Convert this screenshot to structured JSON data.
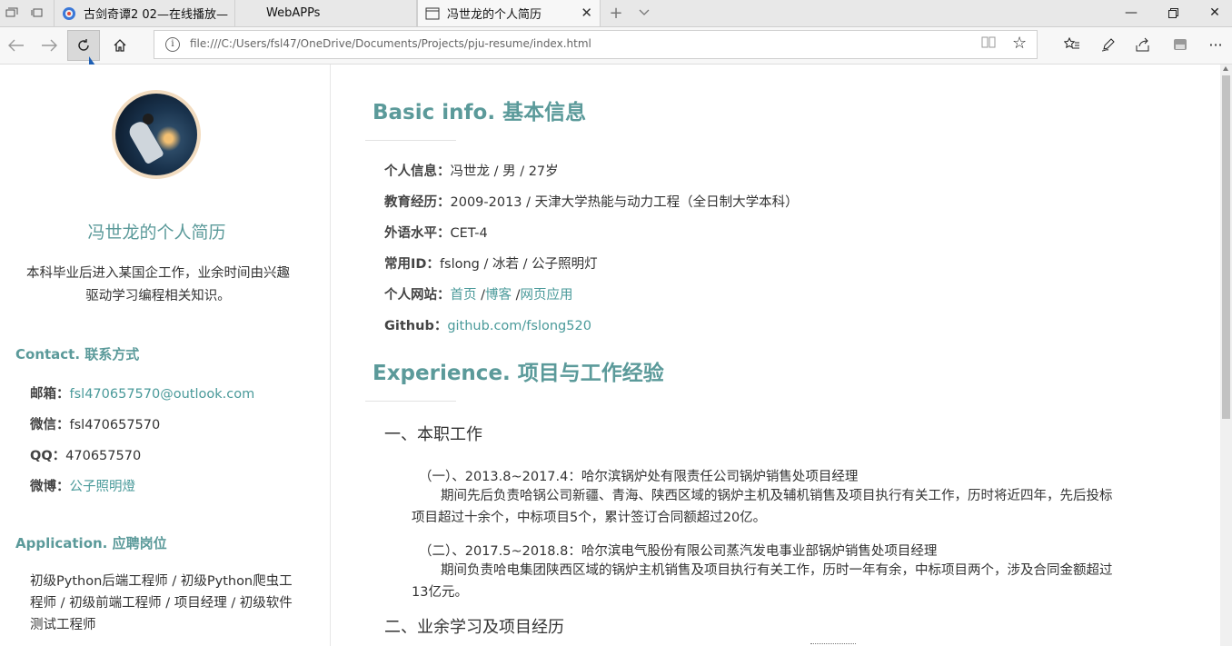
{
  "browser": {
    "tabs": [
      {
        "label": "古剑奇谭2 02—在线播放—",
        "active": false
      },
      {
        "label": "WebAPPs",
        "active": false
      },
      {
        "label": "冯世龙的个人简历",
        "active": true
      }
    ],
    "url": "file:///C:/Users/fsl47/OneDrive/Documents/Projects/pju-resume/index.html"
  },
  "sidebar": {
    "name": "冯世龙的个人简历",
    "intro": "本科毕业后进入某国企工作，业余时间由兴趣驱动学习编程相关知识。",
    "contact_heading": "Contact. 联系方式",
    "contacts": [
      {
        "label": "邮箱：",
        "value": "fsl470657570@outlook.com",
        "link": true
      },
      {
        "label": "微信：",
        "value": "fsl470657570",
        "link": false
      },
      {
        "label": "QQ：",
        "value": "470657570",
        "link": false
      },
      {
        "label": "微博：",
        "value": "公子照明燈",
        "link": true
      }
    ],
    "application_heading": "Application. 应聘岗位",
    "application_text": "初级Python后端工程师 / 初级Python爬虫工程师 / 初级前端工程师 / 项目经理 / 初级软件测试工程师"
  },
  "main": {
    "basic_heading": "Basic info. 基本信息",
    "basic": [
      {
        "label": "个人信息：",
        "value": "冯世龙 / 男 / 27岁"
      },
      {
        "label": "教育经历：",
        "value": "2009-2013 / 天津大学热能与动力工程（全日制大学本科）"
      },
      {
        "label": "外语水平：",
        "value": "CET-4"
      },
      {
        "label": "常用ID：",
        "value": "fslong / 冰若 / 公子照明灯"
      }
    ],
    "website": {
      "label": "个人网站：",
      "links": [
        "首页",
        "博客",
        "网页应用"
      ],
      "sep": " /"
    },
    "github": {
      "label": "Github：",
      "value": "github.com/fslong520"
    },
    "experience_heading": "Experience. 项目与工作经验",
    "section1": "一、本职工作",
    "items": [
      {
        "title": "（一）、2013.8~2017.4：哈尔滨锅炉处有限责任公司锅炉销售处项目经理",
        "desc": "期间先后负责哈锅公司新疆、青海、陕西区域的锅炉主机及辅机销售及项目执行有关工作，历时将近四年，先后投标项目超过十余个，中标项目5个，累计签订合同额超过20亿。"
      },
      {
        "title": "（二）、2017.5~2018.8：哈尔滨电气股份有限公司蒸汽发电事业部锅炉销售处项目经理",
        "desc": "期间负责哈电集团陕西区域的锅炉主机销售及项目执行有关工作，历时一年有余，中标项目两个，涉及合同金额超过13亿元。"
      }
    ],
    "section2": "二、业余学习及项目经历"
  }
}
